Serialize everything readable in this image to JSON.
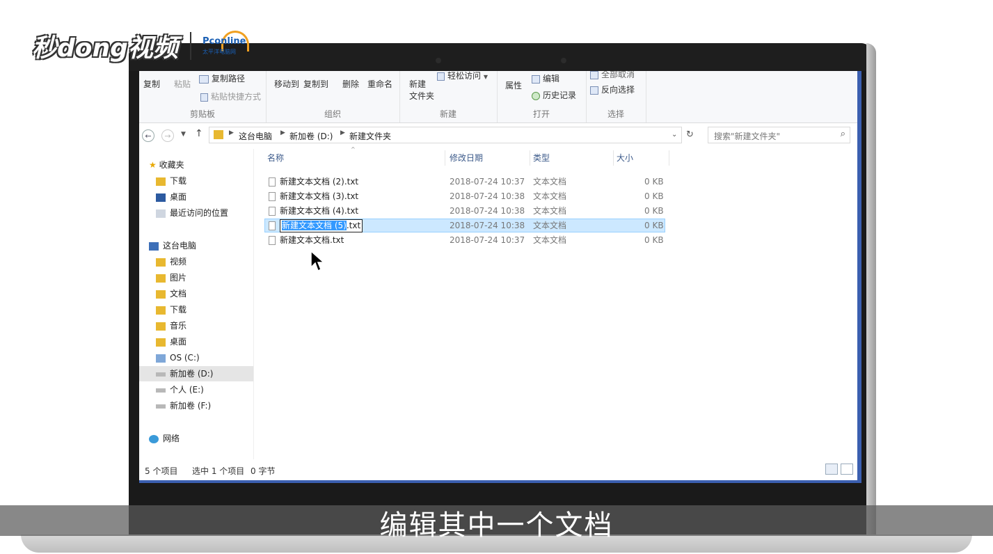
{
  "branding": {
    "logo_text": "秒dong视频",
    "partner_name": "Pconline",
    "partner_sub": "太平洋电脑网"
  },
  "ribbon": {
    "clipboard": {
      "copy_label": "复制",
      "paste_label": "粘贴",
      "copy_path_label": "复制路径",
      "paste_shortcut_label": "粘贴快捷方式",
      "group_label": "剪贴板"
    },
    "organize": {
      "move_to_label": "移动到",
      "copy_to_label": "复制到",
      "delete_label": "删除",
      "rename_label": "重命名",
      "group_label": "组织"
    },
    "new": {
      "new_folder_label_1": "新建",
      "new_folder_label_2": "文件夹",
      "easy_access_label": "轻松访问",
      "group_label": "新建"
    },
    "open": {
      "properties_label": "属性",
      "edit_label": "编辑",
      "history_label": "历史记录",
      "group_label": "打开"
    },
    "select": {
      "select_none_label": "全部取消",
      "invert_label": "反向选择",
      "group_label": "选择"
    }
  },
  "address": {
    "crumbs": [
      "这台电脑",
      "新加卷 (D:)",
      "新建文件夹"
    ],
    "search_placeholder": "搜索\"新建文件夹\""
  },
  "nav": {
    "favorites_label": "收藏夹",
    "favorites": [
      "下载",
      "桌面",
      "最近访问的位置"
    ],
    "this_pc_label": "这台电脑",
    "this_pc": [
      "视频",
      "图片",
      "文档",
      "下载",
      "音乐",
      "桌面",
      "OS (C:)",
      "新加卷 (D:)",
      "个人 (E:)",
      "新加卷 (F:)"
    ],
    "network_label": "网络"
  },
  "files": {
    "columns": [
      "名称",
      "修改日期",
      "类型",
      "大小"
    ],
    "rows": [
      {
        "name": "新建文本文档 (2).txt",
        "date": "2018-07-24 10:37",
        "type": "文本文档",
        "size": "0 KB"
      },
      {
        "name": "新建文本文档 (3).txt",
        "date": "2018-07-24 10:38",
        "type": "文本文档",
        "size": "0 KB"
      },
      {
        "name": "新建文本文档 (4).txt",
        "date": "2018-07-24 10:38",
        "type": "文本文档",
        "size": "0 KB"
      },
      {
        "name_selected_part": "新建文本文档 (5)",
        "name_ext": ".txt",
        "date": "2018-07-24 10:38",
        "type": "文本文档",
        "size": "0 KB"
      },
      {
        "name": "新建文本文档.txt",
        "date": "2018-07-24 10:37",
        "type": "文本文档",
        "size": "0 KB"
      }
    ]
  },
  "status": {
    "count": "5 个项目",
    "selection": "选中 1 个项目",
    "size": "0 字节"
  },
  "caption": "编辑其中一个文档",
  "colors": {
    "accent": "#3399ff",
    "selection_bg": "#cce8ff",
    "screen_border": "#3b5fb0"
  }
}
